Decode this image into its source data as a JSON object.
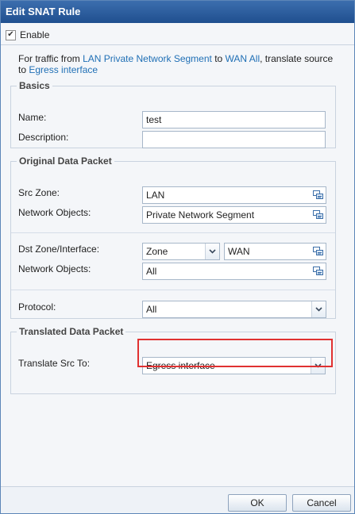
{
  "dialog": {
    "title": "Edit SNAT Rule"
  },
  "enable": {
    "label": "Enable",
    "checked": true
  },
  "description": {
    "part1": "For traffic from ",
    "source": "LAN Private Network Segment",
    "part2": " to ",
    "destination": "WAN All",
    "part3": ", translate source to ",
    "translation": "Egress interface"
  },
  "basics": {
    "legend": "Basics",
    "name_label": "Name:",
    "name_value": "test",
    "description_label": "Description:",
    "description_value": ""
  },
  "original": {
    "legend": "Original Data Packet",
    "src_zone_label": "Src Zone:",
    "src_zone_value": "LAN",
    "src_objects_label": "Network Objects:",
    "src_objects_value": "Private Network Segment",
    "dst_label": "Dst Zone/Interface:",
    "dst_type_value": "Zone",
    "dst_value": "WAN",
    "dst_objects_label": "Network Objects:",
    "dst_objects_value": "All",
    "protocol_label": "Protocol:",
    "protocol_value": "All"
  },
  "translated": {
    "legend": "Translated Data Packet",
    "translate_label": "Translate Src To:",
    "translate_value": "Egress interface"
  },
  "footer": {
    "ok_label": "OK",
    "cancel_label": "Cancel"
  },
  "colors": {
    "link": "#1f6fb5",
    "title_bar": "#2c5d9e",
    "highlight": "#e03131"
  },
  "icons": {
    "picker": "select-objects-icon",
    "dropdown": "chevron-down-icon",
    "check": "checkmark-icon"
  }
}
